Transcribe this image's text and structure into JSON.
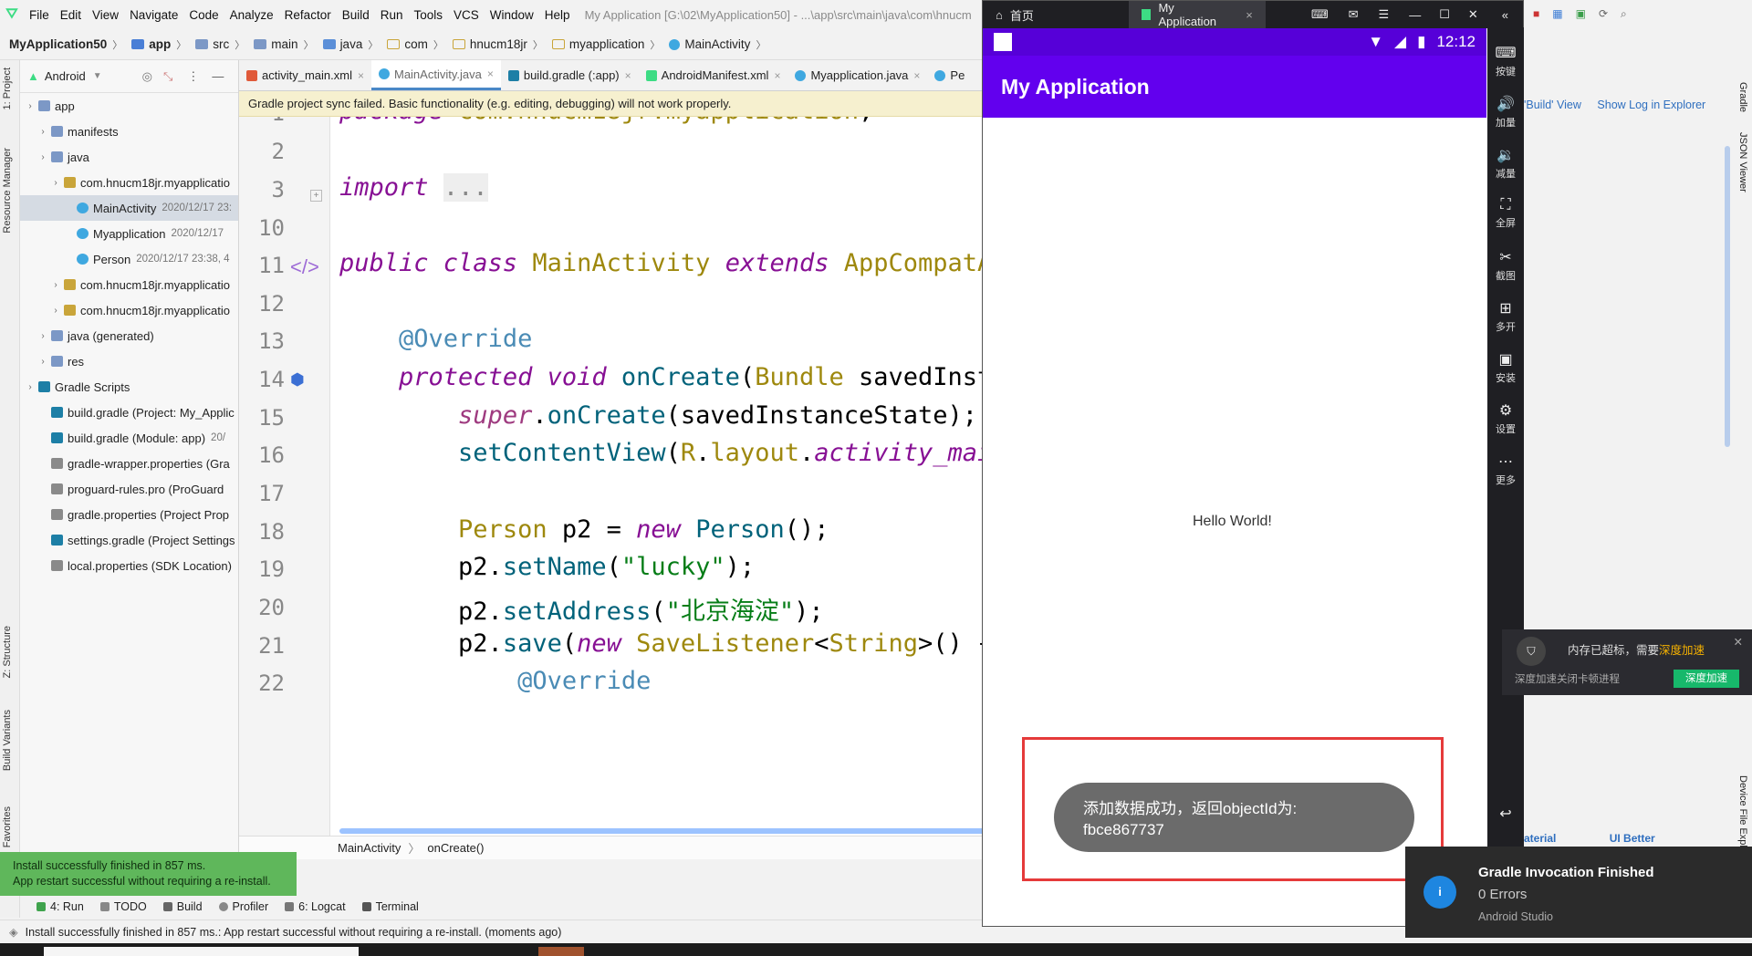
{
  "menu": {
    "items": [
      "File",
      "Edit",
      "View",
      "Navigate",
      "Code",
      "Analyze",
      "Refactor",
      "Build",
      "Run",
      "Tools",
      "VCS",
      "Window",
      "Help"
    ],
    "title": "My Application [G:\\02\\MyApplication50] - ...\\app\\src\\main\\java\\com\\hnucm"
  },
  "breadcrumb": [
    "MyApplication50",
    "app",
    "src",
    "main",
    "java",
    "com",
    "hnucm18jr",
    "myapplication",
    "MainActivity"
  ],
  "project": {
    "view": "Android",
    "tree": [
      {
        "label": "app",
        "indent": 0,
        "icon": "folder-icon",
        "meta": ""
      },
      {
        "label": "manifests",
        "indent": 1,
        "icon": "folder-icon",
        "meta": ""
      },
      {
        "label": "java",
        "indent": 1,
        "icon": "folder-icon",
        "meta": ""
      },
      {
        "label": "com.hnucm18jr.myapplicatio",
        "indent": 2,
        "icon": "package-icon",
        "meta": ""
      },
      {
        "label": "MainActivity",
        "indent": 3,
        "icon": "class-icon",
        "meta": "2020/12/17 23:",
        "selected": true
      },
      {
        "label": "Myapplication",
        "indent": 3,
        "icon": "class-icon",
        "meta": "2020/12/17"
      },
      {
        "label": "Person",
        "indent": 3,
        "icon": "class-icon",
        "meta": "2020/12/17 23:38, 4"
      },
      {
        "label": "com.hnucm18jr.myapplicatio",
        "indent": 2,
        "icon": "package-icon",
        "meta": ""
      },
      {
        "label": "com.hnucm18jr.myapplicatio",
        "indent": 2,
        "icon": "package-icon",
        "meta": ""
      },
      {
        "label": "java (generated)",
        "indent": 1,
        "icon": "folder-icon",
        "meta": ""
      },
      {
        "label": "res",
        "indent": 1,
        "icon": "folder-icon",
        "meta": ""
      },
      {
        "label": "Gradle Scripts",
        "indent": 0,
        "icon": "gradle-icon",
        "meta": ""
      },
      {
        "label": "build.gradle (Project: My_Applic",
        "indent": 1,
        "icon": "gradle-icon",
        "meta": ""
      },
      {
        "label": "build.gradle (Module: app)",
        "indent": 1,
        "icon": "gradle-icon",
        "meta": "20/"
      },
      {
        "label": "gradle-wrapper.properties (Gra",
        "indent": 1,
        "icon": "properties-icon",
        "meta": ""
      },
      {
        "label": "proguard-rules.pro (ProGuard",
        "indent": 1,
        "icon": "properties-icon",
        "meta": ""
      },
      {
        "label": "gradle.properties (Project Prop",
        "indent": 1,
        "icon": "properties-icon",
        "meta": ""
      },
      {
        "label": "settings.gradle (Project Settings",
        "indent": 1,
        "icon": "gradle-icon",
        "meta": ""
      },
      {
        "label": "local.properties (SDK Location)",
        "indent": 1,
        "icon": "properties-icon",
        "meta": ""
      }
    ]
  },
  "left_tabs": [
    "1: Project",
    "Resource Manager",
    "Z: Structure",
    "Build Variants",
    "Favorites"
  ],
  "tabs": [
    {
      "label": "activity_main.xml",
      "active": false
    },
    {
      "label": "MainActivity.java",
      "active": true
    },
    {
      "label": "build.gradle (:app)",
      "active": false
    },
    {
      "label": "AndroidManifest.xml",
      "active": false
    },
    {
      "label": "Myapplication.java",
      "active": false
    },
    {
      "label": "Pe",
      "active": false
    }
  ],
  "banner": "Gradle project sync failed. Basic functionality (e.g. editing, debugging) will not work properly.",
  "editor": {
    "line_numbers": [
      "1",
      "2",
      "3",
      "10",
      "11",
      "12",
      "13",
      "14",
      "15",
      "16",
      "17",
      "18",
      "19",
      "20",
      "21",
      "22"
    ],
    "crumb": [
      "MainActivity",
      "onCreate()"
    ]
  },
  "bottom_tabs": [
    "4: Run",
    "TODO",
    "Build",
    "Profiler",
    "6: Logcat",
    "Terminal"
  ],
  "install_popup": [
    "Install successfully finished in 857 ms.",
    "App restart successful without requiring a re-install."
  ],
  "status_text": "Install successfully finished in 857 ms.: App restart successful without requiring a re-install. (moments ago)",
  "emulator": {
    "tabs": [
      "首页",
      "My Application"
    ],
    "time": "12:12",
    "app_title": "My Application",
    "hello": "Hello World!",
    "toast_line1": "添加数据成功，返回objectId为:",
    "toast_line2": "fbce867737",
    "side_buttons": [
      "按键",
      "加量",
      "减量",
      "全屏",
      "截图",
      "多开",
      "安装",
      "设置",
      "更多"
    ]
  },
  "right_panel": {
    "links": [
      "'Build' View",
      "Show Log in Explorer"
    ],
    "vtabs": [
      "Gradle",
      "JSON Viewer",
      "Device File Explorer"
    ],
    "partial_text": "aterial",
    "partial_text2": "UI Better"
  },
  "mem_tip": {
    "line1": "内存已超标，需要",
    "accel": "深度加速",
    "line2": "深度加速关闭卡顿进程",
    "button": "深度加速"
  },
  "gradle_popup": {
    "title": "Gradle Invocation Finished",
    "errors": "0 Errors",
    "source": "Android Studio"
  }
}
